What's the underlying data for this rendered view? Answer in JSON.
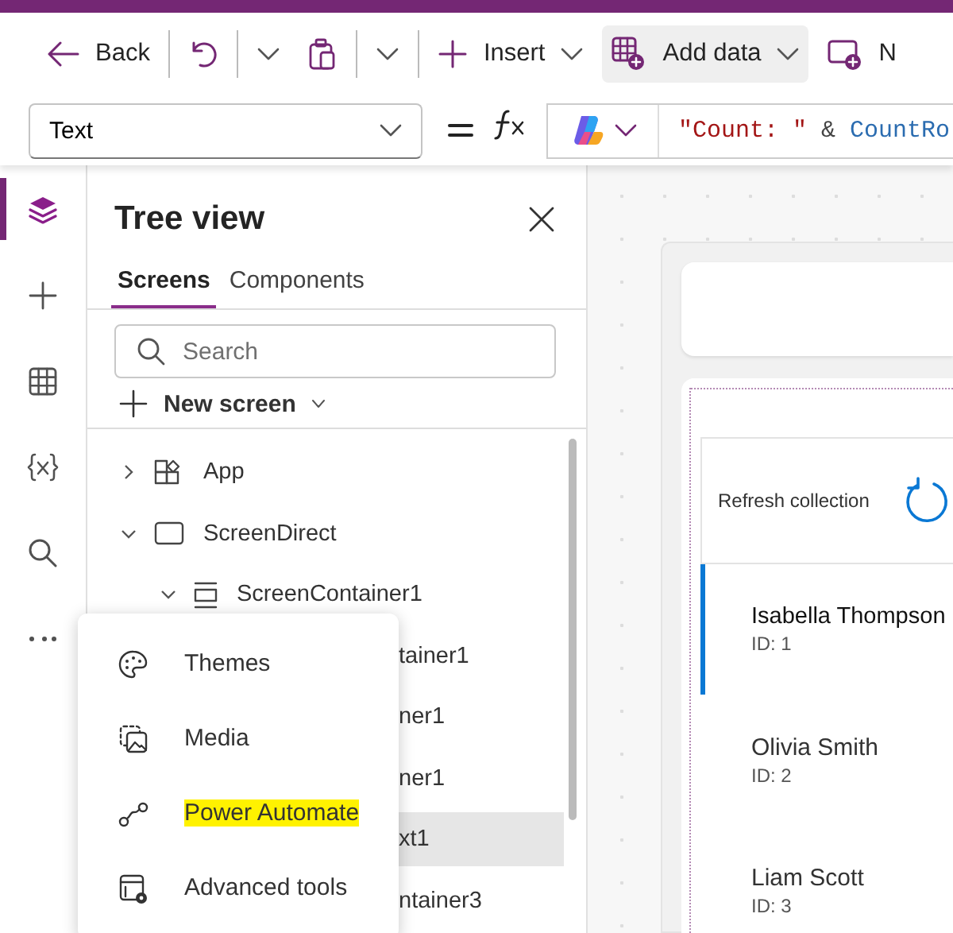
{
  "toolbar": {
    "items": [
      {
        "kind": "back",
        "label": "Back",
        "highlighted": false,
        "dropdown": false
      },
      {
        "kind": "undo",
        "highlighted": false,
        "dropdown": true
      },
      {
        "kind": "paste",
        "highlighted": false,
        "dropdown": true
      },
      {
        "kind": "insert",
        "label": "Insert",
        "highlighted": false,
        "dropdown": true
      },
      {
        "kind": "add_data",
        "label": "Add data",
        "highlighted": true,
        "dropdown": true
      },
      {
        "kind": "new",
        "label": "N",
        "highlighted": false,
        "dropdown": false
      }
    ]
  },
  "formula_bar": {
    "property": "Text",
    "formula": [
      {
        "kind": "string",
        "text": "\"Count: \""
      },
      {
        "kind": "operator",
        "text": "&"
      },
      {
        "kind": "function",
        "text": "CountRo"
      }
    ]
  },
  "rail": [
    {
      "kind": "layers",
      "selected": true
    },
    {
      "kind": "plus",
      "selected": false
    },
    {
      "kind": "table",
      "selected": false
    },
    {
      "kind": "variable",
      "selected": false
    },
    {
      "kind": "search",
      "selected": false
    },
    {
      "kind": "more",
      "selected": false
    }
  ],
  "tree_panel": {
    "title": "Tree view",
    "tabs": [
      {
        "label": "Screens",
        "selected": true
      },
      {
        "label": "Components",
        "selected": false
      }
    ],
    "search": {
      "placeholder": "Search"
    },
    "new_screen": "New screen",
    "nodes": [
      {
        "kind": "app",
        "label": "App",
        "expanded": false,
        "selected": false
      },
      {
        "kind": "screen",
        "label": "ScreenDirect",
        "expanded": true,
        "selected": false,
        "children": [
          {
            "kind": "container",
            "label": "ScreenContainer1",
            "expanded": true,
            "selected": false,
            "children": [
              {
                "label": "tainer1",
                "selected": false
              },
              {
                "label": "ner1",
                "selected": false
              },
              {
                "label": "ner1",
                "selected": false
              },
              {
                "label": "xt1",
                "selected": true
              },
              {
                "label": "ntainer3",
                "selected": false
              }
            ]
          }
        ]
      }
    ]
  },
  "more_menu": {
    "items": [
      {
        "kind": "themes",
        "label": "Themes",
        "highlighted": false
      },
      {
        "kind": "media",
        "label": "Media",
        "highlighted": false
      },
      {
        "kind": "flow",
        "label": "Power Automate",
        "highlighted": true
      },
      {
        "kind": "tools",
        "label": "Advanced tools",
        "highlighted": false
      }
    ]
  },
  "canvas": {
    "refresh_label": "Refresh collection",
    "records": [
      {
        "name": "Isabella Thompson",
        "id": "ID: 1",
        "selected": true
      },
      {
        "name": "Olivia Smith",
        "id": "ID: 2",
        "selected": false
      },
      {
        "name": "Liam Scott",
        "id": "ID: 3",
        "selected": false
      }
    ]
  }
}
